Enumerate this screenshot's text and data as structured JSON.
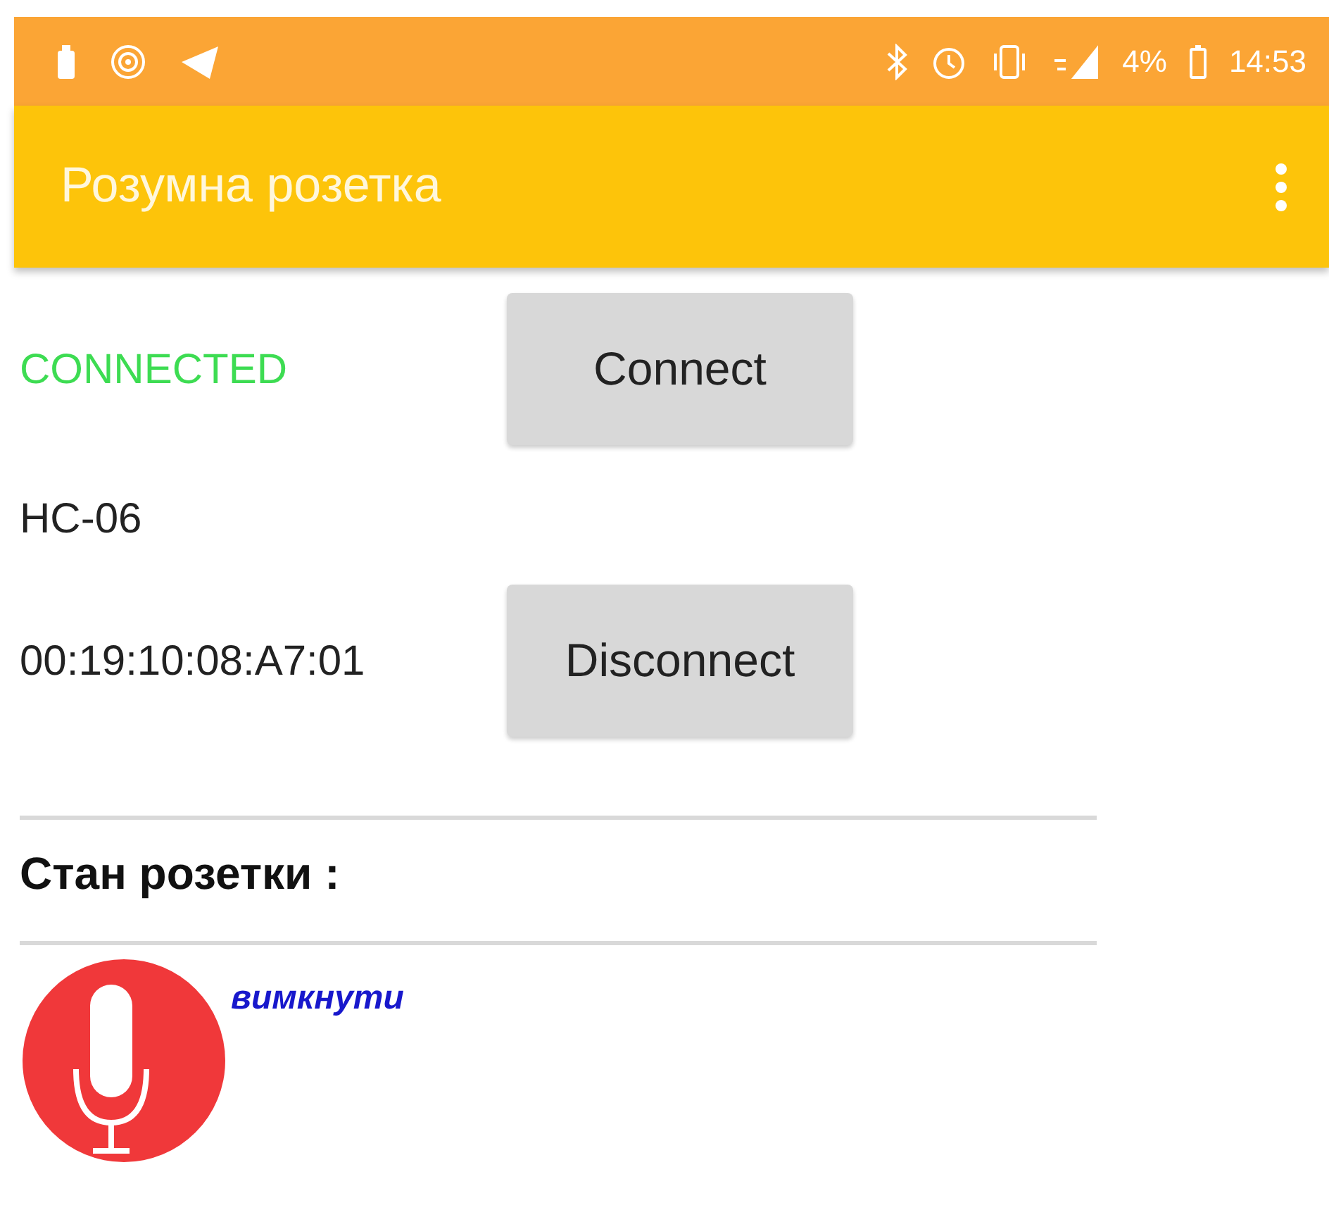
{
  "status_bar": {
    "battery": "4%",
    "time": "14:53"
  },
  "app_bar": {
    "title": "Розумна розетка"
  },
  "connection": {
    "state": "CONNECTED",
    "connected": true,
    "device_name": "HC-06",
    "address": "00:19:10:08:A7:01"
  },
  "buttons": [
    {
      "label": "Connect"
    },
    {
      "label": "Disconnect"
    }
  ],
  "socket": {
    "heading": "Стан розетки :",
    "state": "вимкнути"
  }
}
